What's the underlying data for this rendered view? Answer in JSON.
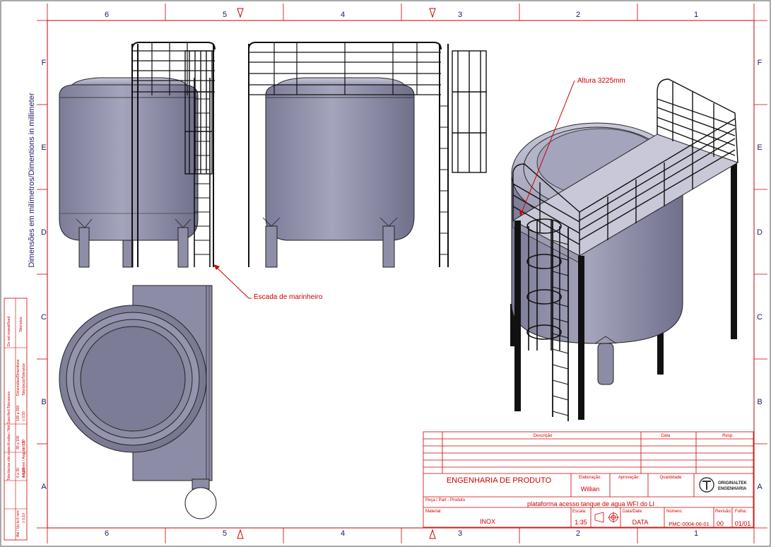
{
  "zones": {
    "columns": [
      "6",
      "5",
      "4",
      "3",
      "2",
      "1"
    ],
    "rows": [
      "F",
      "E",
      "D",
      "C",
      "B",
      "A"
    ]
  },
  "side_label": "Dimensões em milímetros/Dimentions in millimeter",
  "callouts": {
    "altura": "Altura 3225mm",
    "escada": "Escada de marinheiro"
  },
  "tolerance_block": {
    "do_not_repeat": "Do not repeat/fixed",
    "tolerance": "Tolerance",
    "tol_header": "Tolerâncias não especificadas / Not Specified Tolerances",
    "dimensions_label": "Dimensões/Dimentions",
    "tolerance_label": "Tolerância/Tolerance",
    "ranges": [
      "Até / Up to 6 mm",
      "6 a 30",
      "30 a 100",
      "100 a 300"
    ],
    "values": [
      "± 0,10",
      "± 0,20",
      "± 0,30",
      "± 0,50"
    ],
    "angular": "Angulares / Angular: ±1°"
  },
  "title_block": {
    "revision_headers": {
      "descricao": "Descrição",
      "data": "Data",
      "resp": "Resp."
    },
    "department": "ENGENHARIA DE PRODUTO",
    "elaboracao_label": "Elaboração:",
    "elaboracao_value": "Willian",
    "aprovacao_label": "Aprovação:",
    "quantidade_label": "Quantidade",
    "company_line1": "ORIGINALTEK",
    "company_line2": "ENGENHARIA",
    "peca_label": "Peça / Part - Produto",
    "title": "plataforma acesso tanque de agua WFI do LI",
    "material_label": "Material:",
    "material_value": "INOX",
    "escala_label": "Escala:",
    "escala_value": "1:35",
    "data_label": "Data/Date:",
    "data_value": "DATA",
    "numero_label": "Número:",
    "numero_value": "PMC-0004-06-01",
    "revisao_label": "Revisão:",
    "revisao_value": "00",
    "folha_label": "Folha:",
    "folha_value": "01/01"
  },
  "colors": {
    "frame": "#cc0000",
    "body_fill": "#8c8ca6",
    "body_light": "#c4c4d6",
    "line": "#111111"
  }
}
